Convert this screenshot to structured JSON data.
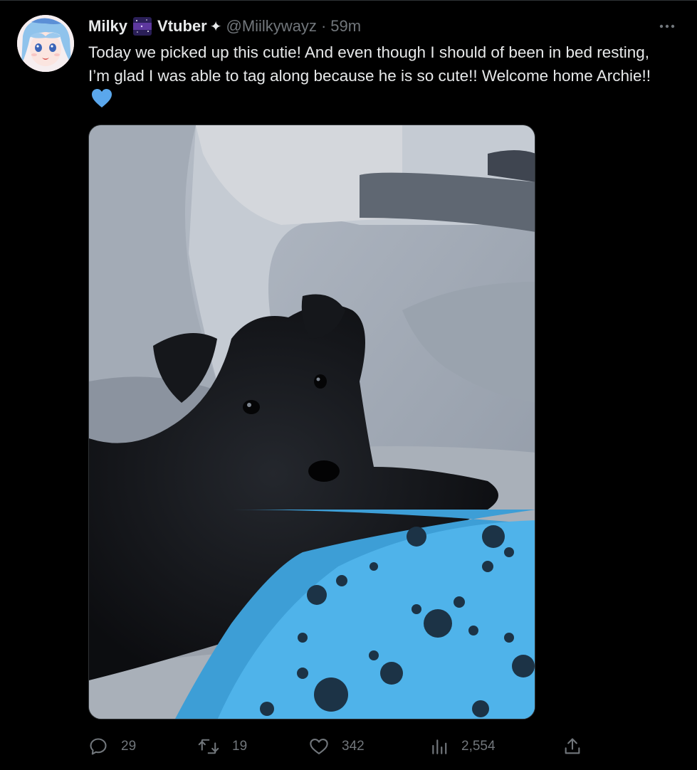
{
  "tweet": {
    "display_name": "Milky",
    "display_name_suffix": "Vtuber",
    "name_emoji": "milky-way-emoji",
    "badge_icon": "sparkle-icon",
    "handle": "@Miilkywayz",
    "separator": "·",
    "time": "59m",
    "text": "Today we picked up this cutie! And even though I should of been in bed resting, I’m glad I was able to tag along because he is so cute!! Welcome home Archie!!",
    "text_emoji": "blue-heart-icon",
    "media_alt": "photo of a black scottish terrier puppy on a car seat with a blue paw-print blanket",
    "stats": {
      "replies": "29",
      "reposts": "19",
      "likes": "342",
      "views": "2,554"
    }
  },
  "colors": {
    "background": "#000000",
    "text": "#e7e9ea",
    "muted": "#71767b",
    "heart_blue": "#5aa7ec"
  }
}
